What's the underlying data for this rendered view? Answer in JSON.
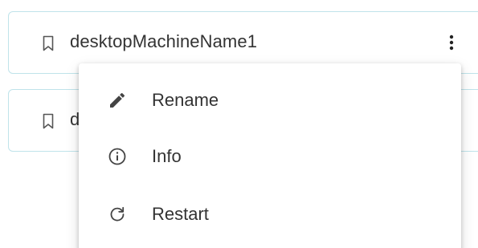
{
  "machines": [
    {
      "name": "desktopMachineName1",
      "icon": "bookmark-icon",
      "menu_icon": "more-vertical-icon"
    },
    {
      "name": "d",
      "icon": "bookmark-icon"
    }
  ],
  "context_menu": {
    "items": [
      {
        "label": "Rename",
        "icon": "pencil-icon"
      },
      {
        "label": "Info",
        "icon": "info-icon"
      },
      {
        "label": "Restart",
        "icon": "restart-icon"
      }
    ]
  },
  "colors": {
    "card_border": "#bfe3ea",
    "text": "#333333",
    "icon": "#555555"
  }
}
